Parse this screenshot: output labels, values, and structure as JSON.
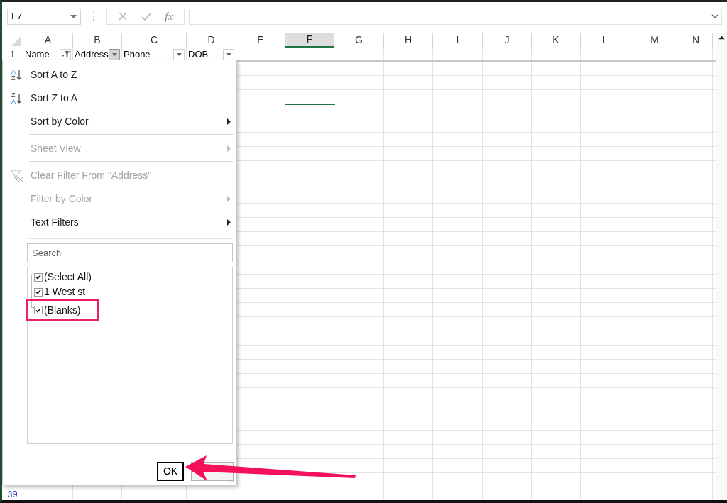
{
  "formula_bar": {
    "name_box": "F7",
    "fx_label": "fx"
  },
  "columns": [
    {
      "label": "A",
      "selected": false
    },
    {
      "label": "B",
      "selected": false
    },
    {
      "label": "C",
      "selected": false
    },
    {
      "label": "D",
      "selected": false
    },
    {
      "label": "E",
      "selected": false
    },
    {
      "label": "F",
      "selected": true
    },
    {
      "label": "G",
      "selected": false
    },
    {
      "label": "H",
      "selected": false
    },
    {
      "label": "I",
      "selected": false
    },
    {
      "label": "J",
      "selected": false
    },
    {
      "label": "K",
      "selected": false
    },
    {
      "label": "L",
      "selected": false
    },
    {
      "label": "M",
      "selected": false
    },
    {
      "label": "N",
      "selected": false
    }
  ],
  "header_row": {
    "number": "1",
    "cells": [
      {
        "text": "Name",
        "filtered": true,
        "open": false
      },
      {
        "text": "Address",
        "filtered": false,
        "open": true
      },
      {
        "text": "Phone",
        "filtered": false,
        "open": false
      },
      {
        "text": "DOB",
        "filtered": false,
        "open": false
      }
    ]
  },
  "last_row": {
    "number": "39",
    "filtered": true
  },
  "filter_menu": {
    "items": [
      {
        "label": "Sort A to Z",
        "kind": "sort",
        "icon_letters": [
          "A",
          "Z"
        ],
        "submenu": false,
        "disabled": false,
        "separator_before": false
      },
      {
        "label": "Sort Z to A",
        "kind": "sort",
        "icon_letters": [
          "Z",
          "A"
        ],
        "submenu": false,
        "disabled": false,
        "separator_before": false
      },
      {
        "label": "Sort by Color",
        "kind": "plain",
        "submenu": true,
        "disabled": false,
        "separator_before": false
      },
      {
        "label": "Sheet View",
        "kind": "plain",
        "submenu": true,
        "disabled": true,
        "separator_before": true
      },
      {
        "label": "Clear Filter From \"Address\"",
        "kind": "clear-filter",
        "submenu": false,
        "disabled": true,
        "separator_before": true
      },
      {
        "label": "Filter by Color",
        "kind": "plain",
        "submenu": true,
        "disabled": true,
        "separator_before": false
      },
      {
        "label": "Text Filters",
        "kind": "plain",
        "submenu": true,
        "disabled": false,
        "separator_before": false
      }
    ],
    "search": {
      "placeholder": "Search"
    },
    "values": [
      {
        "label": "(Select All)",
        "checked": true,
        "highlighted": false
      },
      {
        "label": "1 West st",
        "checked": true,
        "highlighted": false
      },
      {
        "label": "(Blanks)",
        "checked": true,
        "highlighted": true
      }
    ],
    "ok_button": "OK"
  }
}
